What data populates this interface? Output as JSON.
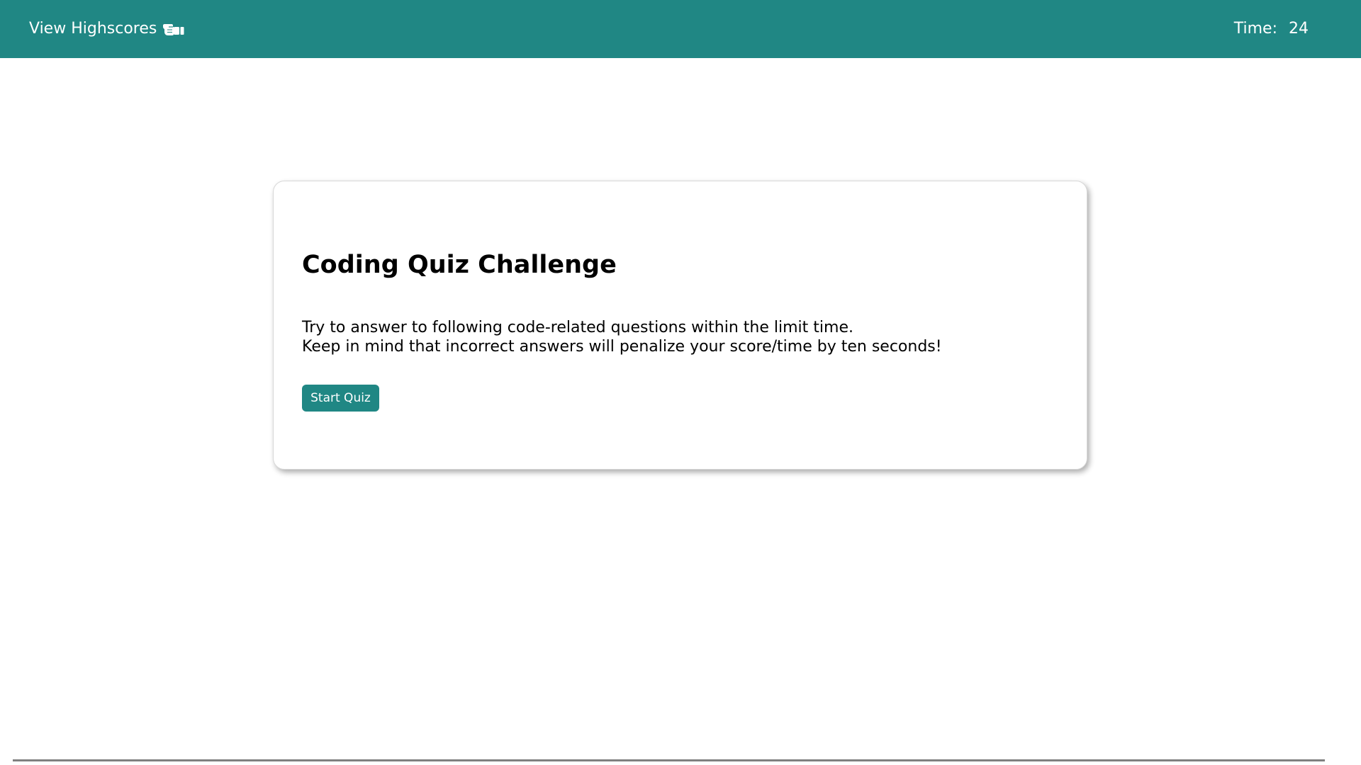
{
  "header": {
    "highscores_label": "View Highscores",
    "highscores_icon": "pointing-hand-icon",
    "timer_label": "Time:",
    "timer_value": "24"
  },
  "intro": {
    "title": "Coding Quiz Challenge",
    "line1": "Try to answer to following code-related questions within the limit time.",
    "line2": "Keep in mind that incorrect answers will penalize your score/time by ten seconds!",
    "start_label": "Start Quiz"
  },
  "colors": {
    "accent": "#208784",
    "background": "#ffffff",
    "text": "#000000",
    "divider": "#808080"
  }
}
